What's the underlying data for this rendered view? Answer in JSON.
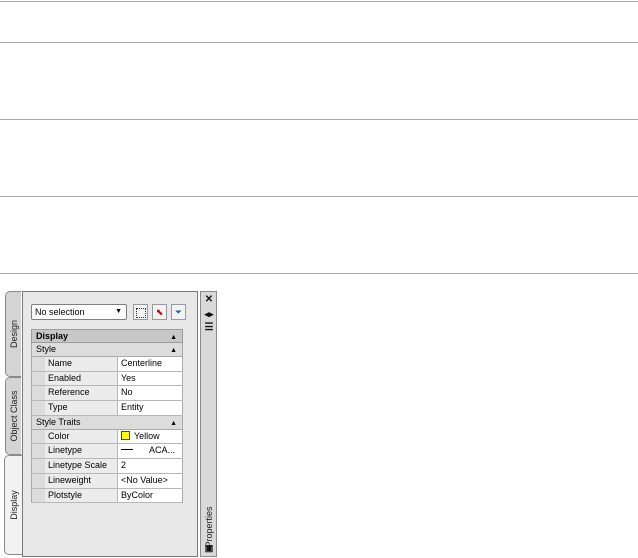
{
  "palette": {
    "tabs": [
      "Design",
      "Object Class",
      "Display"
    ],
    "active_tab": "Display",
    "title": "Properties",
    "titlebar_icons": [
      "close-icon",
      "auto-hide-icon",
      "properties-menu-icon",
      "bottom-icon"
    ]
  },
  "toolbar": {
    "selection_value": "No selection",
    "tool_icons": [
      "quick-select-icon",
      "select-objects-icon",
      "filter-icon"
    ]
  },
  "grid": {
    "category": "Display",
    "sections": [
      {
        "title": "Style",
        "rows": [
          {
            "label": "Name",
            "value": "Centerline"
          },
          {
            "label": "Enabled",
            "value": "Yes"
          },
          {
            "label": "Reference",
            "value": "No"
          },
          {
            "label": "Type",
            "value": "Entity"
          }
        ]
      },
      {
        "title": "Style Traits",
        "rows": [
          {
            "label": "Color",
            "value": "Yellow",
            "swatch": "#ffff00"
          },
          {
            "label": "Linetype",
            "value": "ACA..."
          },
          {
            "label": "Linetype Scale",
            "value": "2"
          },
          {
            "label": "Lineweight",
            "value": "<No Value>"
          },
          {
            "label": "Plotstyle",
            "value": "ByColor"
          }
        ]
      }
    ]
  }
}
